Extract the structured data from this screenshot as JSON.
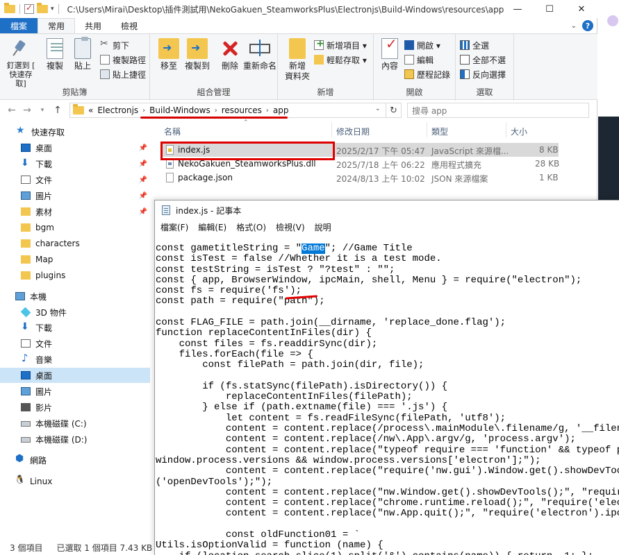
{
  "window": {
    "title_path": "C:\\Users\\Mirai\\Desktop\\插件測試用\\NekoGakuen_SteamworksPlus\\Electronjs\\Build-Windows\\resources\\app",
    "controls": {
      "minimize": "—",
      "maximize": "☐",
      "close": "✕"
    }
  },
  "ribbon": {
    "tabs": [
      "檔案",
      "常用",
      "共用",
      "檢視"
    ],
    "groups": {
      "clipboard": {
        "label": "剪貼簿",
        "pin": "釘選到 [\n快速存取]",
        "copy": "複製",
        "paste": "貼上",
        "cut": "剪下",
        "copy_path": "複製路徑",
        "paste_shortcut": "貼上捷徑"
      },
      "organize": {
        "label": "組合管理",
        "move_to": "移至",
        "copy_to": "複製到",
        "delete": "刪除",
        "rename": "重新命名"
      },
      "new": {
        "label": "新增",
        "new_folder": "新增\n資料夾",
        "new_item": "新增項目 ▾",
        "easy_access": "輕鬆存取 ▾"
      },
      "open": {
        "label": "開啟",
        "properties": "內容",
        "open": "開啟 ▾",
        "edit": "編輯",
        "history": "歷程記錄"
      },
      "select": {
        "label": "選取",
        "select_all": "全選",
        "select_none": "全部不選",
        "invert": "反向選擇"
      }
    }
  },
  "address": {
    "crumbs": [
      "«",
      "Electronjs",
      "Build-Windows",
      "resources",
      "app"
    ],
    "search_placeholder": "搜尋 app"
  },
  "nav": {
    "items": [
      {
        "label": "快速存取",
        "icon": "star-icon"
      },
      {
        "label": "桌面",
        "icon": "desktop-icon",
        "pinned": true
      },
      {
        "label": "下載",
        "icon": "download-icon",
        "pinned": true
      },
      {
        "label": "文件",
        "icon": "documents-icon",
        "pinned": true
      },
      {
        "label": "圖片",
        "icon": "pictures-icon",
        "pinned": true
      },
      {
        "label": "素材",
        "icon": "folder-icon",
        "pinned": true
      },
      {
        "label": "bgm",
        "icon": "folder-icon"
      },
      {
        "label": "characters",
        "icon": "folder-icon"
      },
      {
        "label": "Map",
        "icon": "folder-icon"
      },
      {
        "label": "plugins",
        "icon": "folder-icon"
      },
      {
        "label": "本機",
        "icon": "computer-icon"
      },
      {
        "label": "3D 物件",
        "icon": "3d-objects-icon"
      },
      {
        "label": "下載",
        "icon": "download-icon"
      },
      {
        "label": "文件",
        "icon": "documents-icon"
      },
      {
        "label": "音樂",
        "icon": "music-icon"
      },
      {
        "label": "桌面",
        "icon": "desktop-icon",
        "selected": true
      },
      {
        "label": "圖片",
        "icon": "pictures-icon"
      },
      {
        "label": "影片",
        "icon": "videos-icon"
      },
      {
        "label": "本機磁碟 (C:)",
        "icon": "drive-icon"
      },
      {
        "label": "本機磁碟 (D:)",
        "icon": "drive-icon"
      },
      {
        "label": "網路",
        "icon": "network-icon"
      },
      {
        "label": "Linux",
        "icon": "linux-icon"
      }
    ]
  },
  "files": {
    "headers": [
      "名稱",
      "修改日期",
      "類型",
      "大小"
    ],
    "rows": [
      {
        "name": "index.js",
        "date": "2025/2/17 下午 05:47",
        "type": "JavaScript 來源檔...",
        "size": "8 KB",
        "selected": true
      },
      {
        "name": "NekoGakuen_SteamworksPlus.dll",
        "date": "2025/7/18 上午 06:22",
        "type": "應用程式擴充",
        "size": "28 KB"
      },
      {
        "name": "package.json",
        "date": "2024/8/13 上午 10:02",
        "type": "JSON 來源檔案",
        "size": "1 KB"
      }
    ]
  },
  "status": {
    "count": "3 個項目",
    "selected": "已選取 1 個項目  7.43 KB"
  },
  "notepad": {
    "title": "index.js - 記事本",
    "menu": [
      "檔案(F)",
      "編輯(E)",
      "格式(O)",
      "檢視(V)",
      "說明"
    ],
    "code_before_hl": "const gametitleString = \"",
    "code_hl": "Game",
    "code_after_hl": "\"; //Game Title",
    "code_rest": "const isTest = false //Whether it is a test mode.\nconst testString = isTest ? \"?test\" : \"\";\nconst { app, BrowserWindow, ipcMain, shell, Menu } = require(\"electron\");\nconst fs = require('fs');\nconst path = require(\"path\");\n\nconst FLAG_FILE = path.join(__dirname, 'replace_done.flag');\nfunction replaceContentInFiles(dir) {\n    const files = fs.readdirSync(dir);\n    files.forEach(file => {\n        const filePath = path.join(dir, file);\n\n        if (fs.statSync(filePath).isDirectory()) {\n            replaceContentInFiles(filePath);\n        } else if (path.extname(file) === '.js') {\n            let content = fs.readFileSync(filePath, 'utf8');\n            content = content.replace(/process\\.mainModule\\.filename/g, '__filename');\n            content = content.replace(/nw\\.App\\.argv/g, 'process.argv');\n            content = content.replace(\"typeof require === 'function' && typeof process ===\nwindow.process.versions && window.process.versions['electron'];\");\n            content = content.replace(\"require('nw.gui').Window.get().showDevTools();\", \"r\n('openDevTools');\");\n            content = content.replace(\"nw.Window.get().showDevTools();\", \"require('elect\n            content = content.replace(\"chrome.runtime.reload();\", \"require('electron').i\n            content = content.replace(\"nw.App.quit();\", \"require('electron').ipcRendere\n\n            const oldFunction01 = `\nUtils.isOptionValid = function (name) {\n    if (location.search.slice(1).split('&').contains(name)) { return  1; };"
  }
}
